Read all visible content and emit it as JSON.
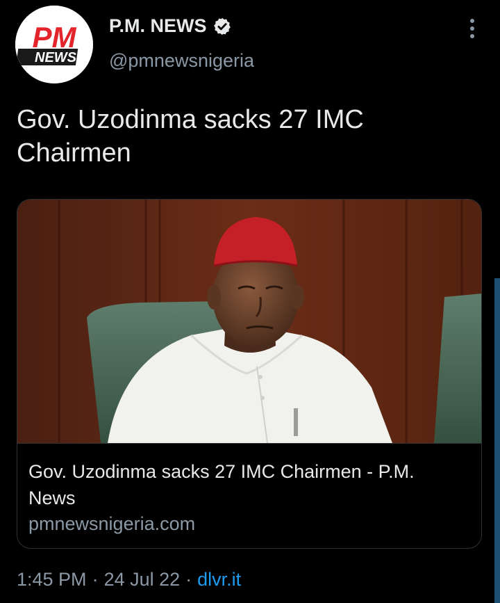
{
  "account": {
    "display_name": "P.M. NEWS",
    "handle": "@pmnewsnigeria",
    "avatar_logo_top": "PM",
    "avatar_logo_bottom": "NEWS",
    "verified": true
  },
  "tweet": {
    "text": "Gov. Uzodinma sacks 27 IMC Chairmen"
  },
  "card": {
    "title": "Gov. Uzodinma sacks 27 IMC Chairmen - P.M. News",
    "domain": "pmnewsnigeria.com"
  },
  "meta": {
    "time": "1:45 PM",
    "sep1": "·",
    "date": "24 Jul 22",
    "sep2": "·",
    "source": "dlvr.it"
  },
  "colors": {
    "background": "#000000",
    "primary_text": "#e7e9ea",
    "secondary_text": "#8b98a5",
    "link": "#1d9bf0",
    "logo_red": "#e3242b",
    "card_border": "#2f3336"
  },
  "icons": [
    "verified-badge-icon",
    "more-options-icon"
  ]
}
